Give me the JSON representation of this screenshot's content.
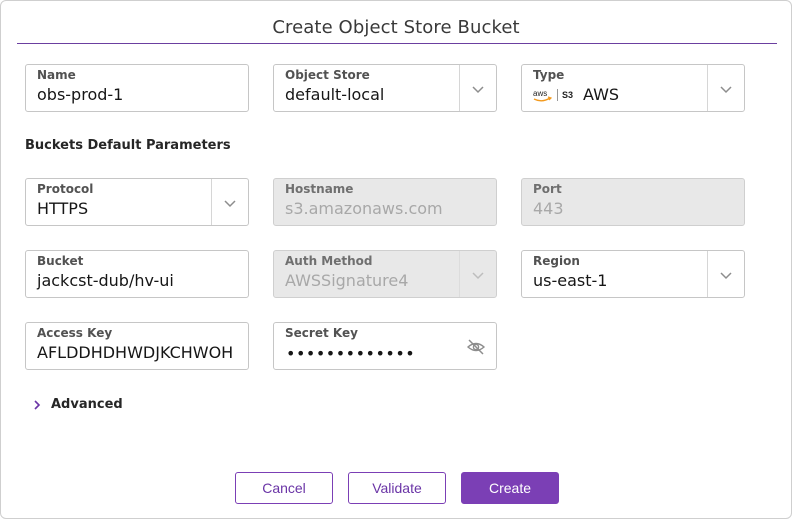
{
  "dialog": {
    "title": "Create Object Store Bucket"
  },
  "fields": {
    "name": {
      "label": "Name",
      "value": "obs-prod-1"
    },
    "object_store": {
      "label": "Object Store",
      "value": "default-local"
    },
    "type": {
      "label": "Type",
      "value": "AWS",
      "icons": [
        "aws-logo-icon",
        "s3-logo-icon"
      ]
    }
  },
  "section": {
    "title": "Buckets Default Parameters"
  },
  "params": {
    "protocol": {
      "label": "Protocol",
      "value": "HTTPS"
    },
    "hostname": {
      "label": "Hostname",
      "value": "s3.amazonaws.com"
    },
    "port": {
      "label": "Port",
      "value": "443"
    },
    "bucket": {
      "label": "Bucket",
      "value": "jackcst-dub/hv-ui"
    },
    "auth_method": {
      "label": "Auth Method",
      "value": "AWSSignature4"
    },
    "region": {
      "label": "Region",
      "value": "us-east-1"
    },
    "access_key": {
      "label": "Access Key",
      "value": "AFLDDHDHWDJKCHWOH"
    },
    "secret_key": {
      "label": "Secret Key",
      "value": "•••••••••••••"
    }
  },
  "advanced": {
    "label": "Advanced"
  },
  "buttons": {
    "cancel": "Cancel",
    "validate": "Validate",
    "create": "Create"
  },
  "colors": {
    "accent": "#7b3fb5",
    "disabled_bg": "#e8e8e8",
    "border": "#c6c6c6"
  }
}
